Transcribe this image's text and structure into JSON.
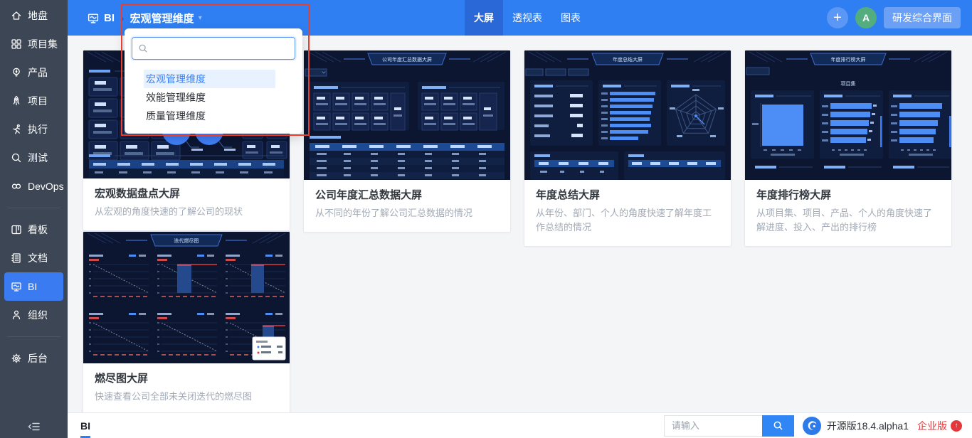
{
  "colors": {
    "topbar": "#2f7ff2",
    "accent": "#3c82f7",
    "sidebar": "#3d4655",
    "sidebar_active": "#3a7bf2",
    "danger": "#e4393c",
    "annotation": "#e8402f"
  },
  "icons": {
    "plus": "+",
    "caret_down": "▾",
    "breadcrumb_separator": "›",
    "upgrade": "↑"
  },
  "sidebar": {
    "items": [
      {
        "label": "地盘",
        "icon": "home-icon"
      },
      {
        "label": "项目集",
        "icon": "program-icon"
      },
      {
        "label": "产品",
        "icon": "product-icon"
      },
      {
        "label": "项目",
        "icon": "project-icon"
      },
      {
        "label": "执行",
        "icon": "execution-icon"
      },
      {
        "label": "测试",
        "icon": "test-icon"
      },
      {
        "label": "DevOps",
        "icon": "devops-icon"
      },
      {
        "label": "看板",
        "icon": "kanban-icon"
      },
      {
        "label": "文档",
        "icon": "doc-icon"
      },
      {
        "label": "BI",
        "icon": "bi-icon",
        "active": true
      },
      {
        "label": "组织",
        "icon": "org-icon"
      },
      {
        "label": "后台",
        "icon": "admin-icon"
      }
    ]
  },
  "topbar": {
    "app_label": "BI",
    "dimension_label": "宏观管理维度",
    "tabs": [
      {
        "label": "大屏",
        "active": true
      },
      {
        "label": "透视表",
        "active": false
      },
      {
        "label": "图表",
        "active": false
      }
    ],
    "avatar_initial": "A",
    "action_button_label": "研发综合界面"
  },
  "dimension_dropdown": {
    "search_value": "",
    "options": [
      {
        "label": "宏观管理维度",
        "selected": true
      },
      {
        "label": "效能管理维度",
        "selected": false
      },
      {
        "label": "质量管理维度",
        "selected": false
      }
    ]
  },
  "cards": [
    {
      "title": "宏观数据盘点大屏",
      "description": "从宏观的角度快速的了解公司的现状"
    },
    {
      "title": "公司年度汇总数据大屏",
      "description": "从不同的年份了解公司汇总数据的情况",
      "banner": "公司年度汇总数据大屏"
    },
    {
      "title": "年度总结大屏",
      "description": "从年份、部门、个人的角度快速了解年度工作总结的情况",
      "banner": "年度总结大屏"
    },
    {
      "title": "年度排行榜大屏",
      "description": "从项目集、项目、产品、个人的角度快速了解进度、投入、产出的排行榜",
      "banner": "年度排行榜大屏",
      "group_label": "项目集"
    },
    {
      "title": "燃尽图大屏",
      "description": "快速查看公司全部未关闭迭代的燃尽图",
      "banner": "迭代燃尽图"
    }
  ],
  "footer": {
    "tab_label": "BI",
    "search_placeholder": "请输入",
    "version_label": "开源版18.4.alpha1",
    "edition_label": "企业版"
  }
}
